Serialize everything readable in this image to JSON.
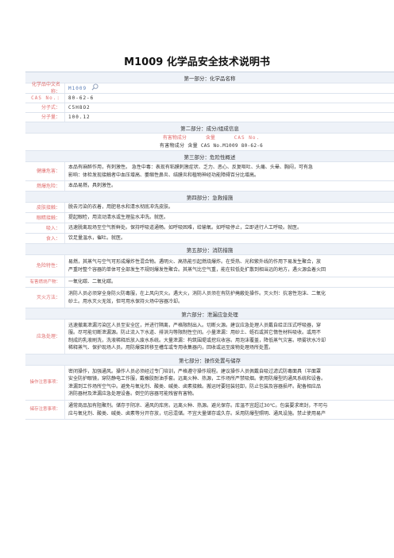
{
  "title": "M1009 化学品安全技术说明书",
  "part1": {
    "heading": "第一部分：化学品名称",
    "name_label": "化学品中文名称：",
    "name_value": "M1009",
    "cas_label": "CAS No.:",
    "cas_value": "80-62-6",
    "formula_label": "分子式：",
    "formula_value": "C5H8O2",
    "mw_label": "分子量：",
    "mw_value": "100.12"
  },
  "part2": {
    "heading": "第二部分：成分/组成信息",
    "col1": "有害物成分",
    "col2": "含量",
    "col3": "CAS No.",
    "row": "有害物成分 含量 CAS No.M1009 80-62-6"
  },
  "part3": {
    "heading": "第三部分：危险性概述",
    "health_label": "健康危害：",
    "health_line1": "本品有麻醉作用，有刺激性。 急性中毒：表现有粘膜刺激症状、乏力、恶心、反复呕吐、头痛、头晕、胸闷，可有急",
    "health_line2": "影响：体检发现接触者中血压增高、萎缩性鼻炎、结膜炎和植物神经功能障碍百分比增高。",
    "fire_label": "燃爆危险：",
    "fire_value": "本品易燃，具刺激性。"
  },
  "part4": {
    "heading": "第四部分：急救措施",
    "skin_label": "皮肤接触：",
    "skin_value": "脱去污染的衣着，用肥皂水和清水彻底冲洗皮肤。",
    "eye_label": "眼睛接触：",
    "eye_value": "提起眼睑，用流动清水或生理盐水冲洗。就医。",
    "inhal_label": "吸入：",
    "inhal_value": "迅速脱离现场至空气新鲜处。保持呼吸道通畅。如呼吸困难，给输氧。如呼吸停止，立即进行人工呼吸。就医。",
    "ingest_label": "食入：",
    "ingest_value": "饮足量温水，催吐。就医。"
  },
  "part5": {
    "heading": "第五部分：消防措施",
    "hazard_label": "危险特性：",
    "hazard_line1": "易燃，其蒸气与空气可形成爆炸性混合物。遇明火、高热能引起燃烧爆炸。在受热、光和紫外线的作用下易发生聚合，放",
    "hazard_line2": "严重时整个容器的单体可全部发生不规则爆发性聚合。其蒸气比空气重，能在较低处扩散到相当远的地方，遇火源会着火回",
    "combust_label": "有害燃烧产物：",
    "combust_value": "一氧化碳、二氧化碳。",
    "extinguish_label": "灭火方法：",
    "extinguish_line1": "消防人员必须穿全身防火防毒服，在上风向灭火。遇大火，消防人员须在有防护掩蔽处操作。灭火剂：抗溶性泡沫、二氧化",
    "extinguish_line2": "砂土。用水灭火无效，但可用水保持火场中容器冷却。"
  },
  "part6": {
    "heading": "第六部分：泄漏应急处理",
    "label": "应急处理：",
    "line1": "迅速撤离泄漏污染区人员至安全区，并进行隔离，严格限制出入。切断火源。建议应急处理人员戴自给正压式呼吸器，穿",
    "line2": "服。尽可能切断泄漏源。防止流入下水道、排洪沟等限制性空间。小量泄漏：用砂土、蛭石或其它惰性材料吸收。或用不",
    "line3": "制成的乳液刷洗，洗液稀释后放入废水系统。大量泄漏：构筑围堤或挖坑收容。用泡沫覆盖，降低蒸气灾害。喷雾状水冷却",
    "line4": "稀释蒸气、保护现场人员。用防爆泵转移至槽车或专用收集器内，回收或运至废物处理场所处置。"
  },
  "part7": {
    "heading": "第七部分：操作处置与储存",
    "op_label": "操作注意事项：",
    "op_line1": "密闭操作，加强通风。操作人员必须经过专门培训，严格遵守操作规程。建议操作人员佩戴自吸过滤式防毒面具（半面罩",
    "op_line2": "安全防护眼镜，穿防静电工作服，戴橡胶耐油手套。远离火种、热源，工作场所严禁吸烟。使用防爆型的通风系统和设备。",
    "op_line3": "泄漏到工作场所空气中。避免与氧化剂、酸类、碱类、卤素接触。搬运时要轻装轻卸，防止包装及容器损坏。配备相应品",
    "op_line4": "消防器材及泄漏应急处理设备。倒空的容器可能残留有害物。",
    "store_label": "储存注意事项：",
    "store_line1": "通常商品加有阻聚剂。储存于阴凉、通风的库房。远离火种、热源。避光保存。库温不宜超过30℃。包装要求密封，不可与",
    "store_line2": "应与氧化剂、酸类、碱类、卤素等分开存放，切忌混储。不宜大量储存或久存。采用防爆型照明、通风设施。禁止使用易产"
  }
}
